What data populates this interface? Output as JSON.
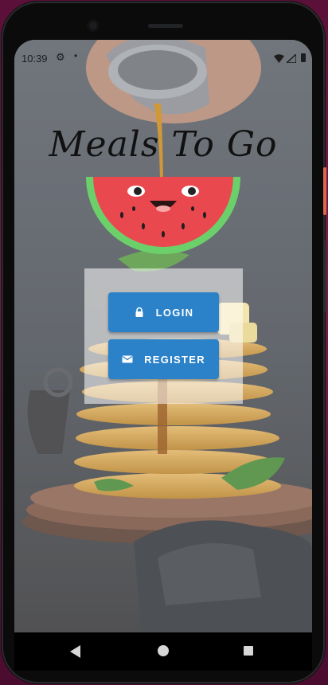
{
  "status_bar": {
    "time": "10:39",
    "icons": [
      "settings-icon",
      "notification-dot-icon",
      "wifi-icon",
      "cellular-icon",
      "battery-icon"
    ]
  },
  "app": {
    "title": "Meals To Go",
    "mascot": "watermelon-mascot"
  },
  "buttons": {
    "login": {
      "label": "LOGIN",
      "icon": "lock-icon"
    },
    "register": {
      "label": "REGISTER",
      "icon": "email-icon"
    }
  },
  "colors": {
    "button_bg": "#2b82c9",
    "watermelon_rind": "#6cd06a",
    "watermelon_flesh": "#e9484f"
  },
  "nav_bar": {
    "icons": [
      "back-icon",
      "home-icon",
      "recents-icon"
    ]
  }
}
